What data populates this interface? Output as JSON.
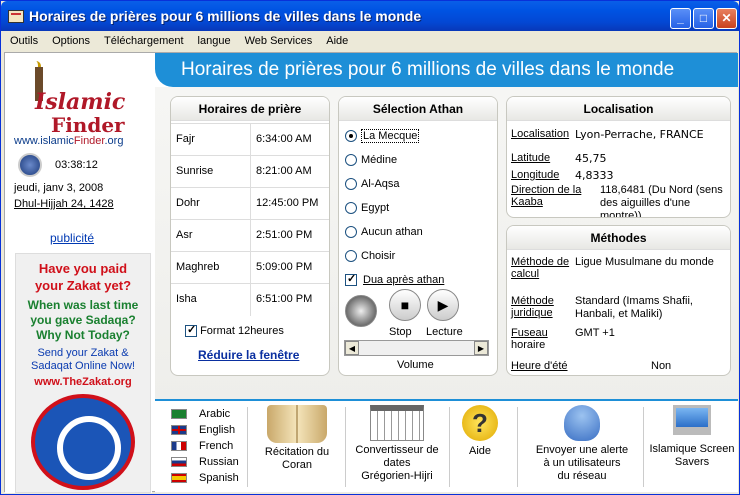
{
  "window": {
    "title": "Horaires de prières pour 6 millions de villes dans le monde"
  },
  "menu": [
    "Outils",
    "Options",
    "Téléchargement",
    "langue",
    "Web Services",
    "Aide"
  ],
  "left": {
    "logo_islamic": "Islamic",
    "logo_finder": "Finder",
    "site_prefix": "www.islamic",
    "site_accent": "Finder",
    "site_suffix": ".org",
    "time": "03:38:12",
    "date": "jeudi, janv 3, 2008",
    "hijri": "Dhul-Hijjah 24, 1428",
    "pub": "publicité",
    "zakat_line1a": "Have you paid",
    "zakat_line1b": "your Zakat yet?",
    "zakat_line2a": "When was last time",
    "zakat_line2b": "you gave Sadaqa?",
    "zakat_line2c": "Why Not Today?",
    "zakat_line3a": "Send your Zakat &",
    "zakat_line3b": "Sadaqat Online Now!",
    "zakat_url": "www.TheZakat.org"
  },
  "header": "Horaires de prières pour 6 millions de villes dans le monde",
  "prayer": {
    "title": "Horaires de prière",
    "rows": [
      {
        "name": "Fajr",
        "time": "6:34:00 AM"
      },
      {
        "name": "Sunrise",
        "time": "8:21:00 AM"
      },
      {
        "name": "Dohr",
        "time": "12:45:00 PM"
      },
      {
        "name": "Asr",
        "time": "2:51:00 PM"
      },
      {
        "name": "Maghreb",
        "time": "5:09:00 PM"
      },
      {
        "name": "Isha",
        "time": "6:51:00 PM"
      }
    ],
    "format_label": "Format 12heures",
    "reduce_link": "Réduire la fenêtre"
  },
  "athan": {
    "title": "Sélection Athan",
    "options": [
      "La Mecque",
      "Médine",
      "Al-Aqsa",
      "Egypt",
      "Aucun athan",
      "Choisir"
    ],
    "selected": 0,
    "dua_label": "Dua après athan",
    "stop": "Stop",
    "play": "Lecture",
    "volume": "Volume"
  },
  "location": {
    "title": "Localisation",
    "loc_label": "Localisation",
    "loc_value": "Lyon-Perrache, FRANCE",
    "lat_label": "Latitude",
    "lat_value": "45,75",
    "lon_label": "Longitude",
    "lon_value": "4,8333",
    "kaaba_label1": "Direction de la",
    "kaaba_label2": "Kaaba",
    "kaaba_value1": "118,6481 (Du Nord (sens",
    "kaaba_value2": "des aiguilles d'une",
    "kaaba_value3": "montre))"
  },
  "methods": {
    "title": "Méthodes",
    "calc_label1": "Méthode de",
    "calc_label2": "calcul",
    "calc_value": "Ligue Musulmane du monde",
    "jur_label1": "Méthode",
    "jur_label2": "juridique",
    "jur_value1": "Standard (Imams Shafii,",
    "jur_value2": "Hanbali, et Maliki)",
    "tz_label1": "Fuseau",
    "tz_label2": "horaire",
    "tz_value": "GMT +1",
    "dst_label": "Heure d'été",
    "dst_value": "Non"
  },
  "languages": [
    "Arabic",
    "English",
    "French",
    "Russian",
    "Spanish"
  ],
  "tools": {
    "quran1": "Récitation du",
    "quran2": "Coran",
    "conv1": "Convertisseur de",
    "conv2": "dates",
    "conv3": "Grégorien-Hijri",
    "help": "Aide",
    "alert1": "Envoyer une alerte",
    "alert2": "à un utilisateurs",
    "alert3": "du réseau",
    "saver1": "Islamique Screen",
    "saver2": "Savers"
  },
  "colors": {
    "accent": "#1e8fd7",
    "titlebar": "#0054e3",
    "brand_red": "#b01828"
  }
}
